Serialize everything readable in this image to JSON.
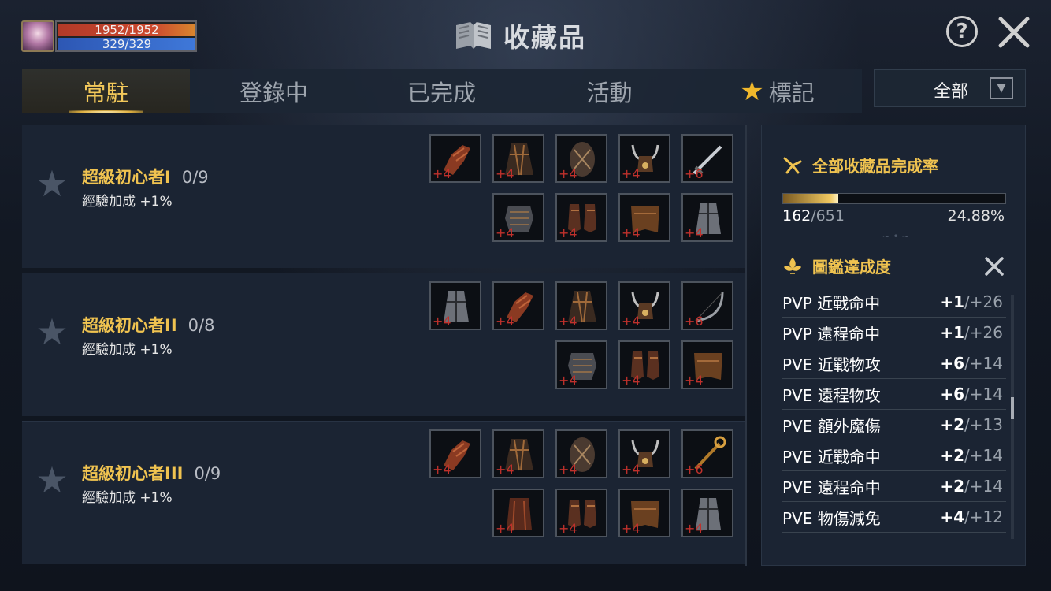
{
  "hud": {
    "hp": "1952/1952",
    "mp": "329/329"
  },
  "header": {
    "title": "收藏品",
    "help": "?"
  },
  "tabs": [
    {
      "label": "常駐",
      "active": true
    },
    {
      "label": "登錄中"
    },
    {
      "label": "已完成"
    },
    {
      "label": "活動"
    },
    {
      "label": "標記",
      "icon": "star-icon"
    }
  ],
  "filter": {
    "selected": "全部",
    "arrow": "▼"
  },
  "collections": [
    {
      "name": "超級初心者I",
      "count": "0/9",
      "bonus": "經驗加成 +1%",
      "items": [
        {
          "icon": "gauntlet-icon",
          "plus": "+4"
        },
        {
          "icon": "cloak-icon",
          "plus": "+4"
        },
        {
          "icon": "shield-icon",
          "plus": "+4"
        },
        {
          "icon": "horned-helmet-icon",
          "plus": "+4"
        },
        {
          "icon": "sword-icon",
          "plus": "+6"
        },
        {
          "icon": "chest-armor-icon",
          "plus": "+4"
        },
        {
          "icon": "boots-icon",
          "plus": "+4"
        },
        {
          "icon": "pants-icon",
          "plus": "+4"
        },
        {
          "icon": "robe-icon",
          "plus": "+4"
        }
      ]
    },
    {
      "name": "超級初心者II",
      "count": "0/8",
      "bonus": "經驗加成 +1%",
      "items": [
        {
          "icon": "robe-icon",
          "plus": "+4"
        },
        {
          "icon": "gauntlet-icon",
          "plus": "+4"
        },
        {
          "icon": "cloak-icon",
          "plus": "+4"
        },
        {
          "icon": "horned-helmet-icon",
          "plus": "+4"
        },
        {
          "icon": "bow-icon",
          "plus": "+6"
        },
        {
          "icon": "chest-armor-icon",
          "plus": "+4"
        },
        {
          "icon": "boots-icon",
          "plus": "+4"
        },
        {
          "icon": "pants-icon",
          "plus": "+4"
        }
      ]
    },
    {
      "name": "超級初心者III",
      "count": "0/9",
      "bonus": "經驗加成 +1%",
      "items": [
        {
          "icon": "gauntlet-icon",
          "plus": "+4"
        },
        {
          "icon": "cloak-icon",
          "plus": "+4"
        },
        {
          "icon": "shield-icon",
          "plus": "+4"
        },
        {
          "icon": "horned-helmet-icon",
          "plus": "+4"
        },
        {
          "icon": "staff-icon",
          "plus": "+6"
        },
        {
          "icon": "cape-icon",
          "plus": "+4"
        },
        {
          "icon": "boots-icon",
          "plus": "+4"
        },
        {
          "icon": "pants-icon",
          "plus": "+4"
        },
        {
          "icon": "robe-icon",
          "plus": "+4"
        }
      ]
    }
  ],
  "summary": {
    "title": "全部收藏品完成率",
    "collected": "162",
    "total": "/651",
    "percent": "24.88%",
    "progress_fraction": 0.2488
  },
  "codex": {
    "title": "圖鑑達成度",
    "stats": [
      {
        "label": "PVP 近戰命中",
        "current": "+1",
        "max": "/+26"
      },
      {
        "label": "PVP 遠程命中",
        "current": "+1",
        "max": "/+26"
      },
      {
        "label": "PVE 近戰物攻",
        "current": "+6",
        "max": "/+14"
      },
      {
        "label": "PVE 遠程物攻",
        "current": "+6",
        "max": "/+14"
      },
      {
        "label": "PVE 額外魔傷",
        "current": "+2",
        "max": "/+13"
      },
      {
        "label": "PVE 近戰命中",
        "current": "+2",
        "max": "/+14"
      },
      {
        "label": "PVE 遠程命中",
        "current": "+2",
        "max": "/+14"
      },
      {
        "label": "PVE 物傷減免",
        "current": "+4",
        "max": "/+12"
      }
    ]
  },
  "colors": {
    "gold": "#f0c350",
    "tab_inactive": "#9ea5ae",
    "plus_red": "#c0312c",
    "panel_bg": "#1b2433"
  }
}
